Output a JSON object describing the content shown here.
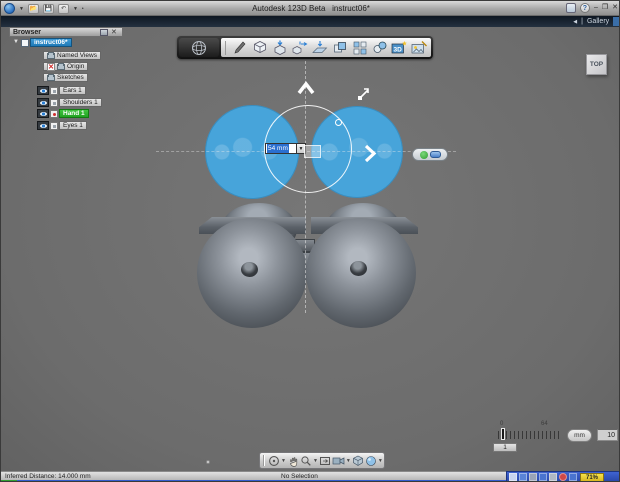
{
  "colors": {
    "selection_blue": "#47a4da",
    "tree_highlight_blue": "#1f7ab8",
    "tree_highlight_green": "#22a322",
    "taskbar_blue": "#2c53c9"
  },
  "window": {
    "app_title": "Autodesk 123D Beta   instruct06*",
    "help_label": "?",
    "minimize_label": "–",
    "maximize_label": "❐",
    "close_label": "✕"
  },
  "gallery_bar": {
    "back_glyph": "◀",
    "divider": "|",
    "gallery_label": "Gallery"
  },
  "browser": {
    "title": "Browser",
    "close_glyph": "✕",
    "items": [
      {
        "label": "instruct06*"
      },
      {
        "label": "Named Views"
      },
      {
        "label": "Origin"
      },
      {
        "label": "Sketches"
      },
      {
        "label": "Ears 1"
      },
      {
        "label": "Shoulders 1"
      },
      {
        "label": "Hand 1"
      },
      {
        "label": "Eyes 1"
      }
    ]
  },
  "main_toolbar": {
    "icons": [
      "app-menu",
      "sketch-pencil",
      "primitive-cube",
      "press-pull",
      "move",
      "snap",
      "duplicate",
      "pattern",
      "combine",
      "scene-3d",
      "capture-image"
    ]
  },
  "viewcube": {
    "face_label": "TOP"
  },
  "viewport": {
    "dimension_input": {
      "value": "54 mm"
    },
    "dropdown_glyph": "▼"
  },
  "nav_toolbar": {
    "icons": [
      "orbit",
      "pan",
      "zoom",
      "fit",
      "camera-view",
      "display-style",
      "material"
    ],
    "caret_glyph": "▼"
  },
  "grid_controls": {
    "ruler_min": "0",
    "ruler_max": "64",
    "snap_value": "1",
    "units_label": "mm",
    "grid_size": "10"
  },
  "statusbar": {
    "message": "Inferred Distance: 14.000 mm",
    "selection": "No Selection"
  },
  "taskbar": {
    "battery": "71%"
  }
}
